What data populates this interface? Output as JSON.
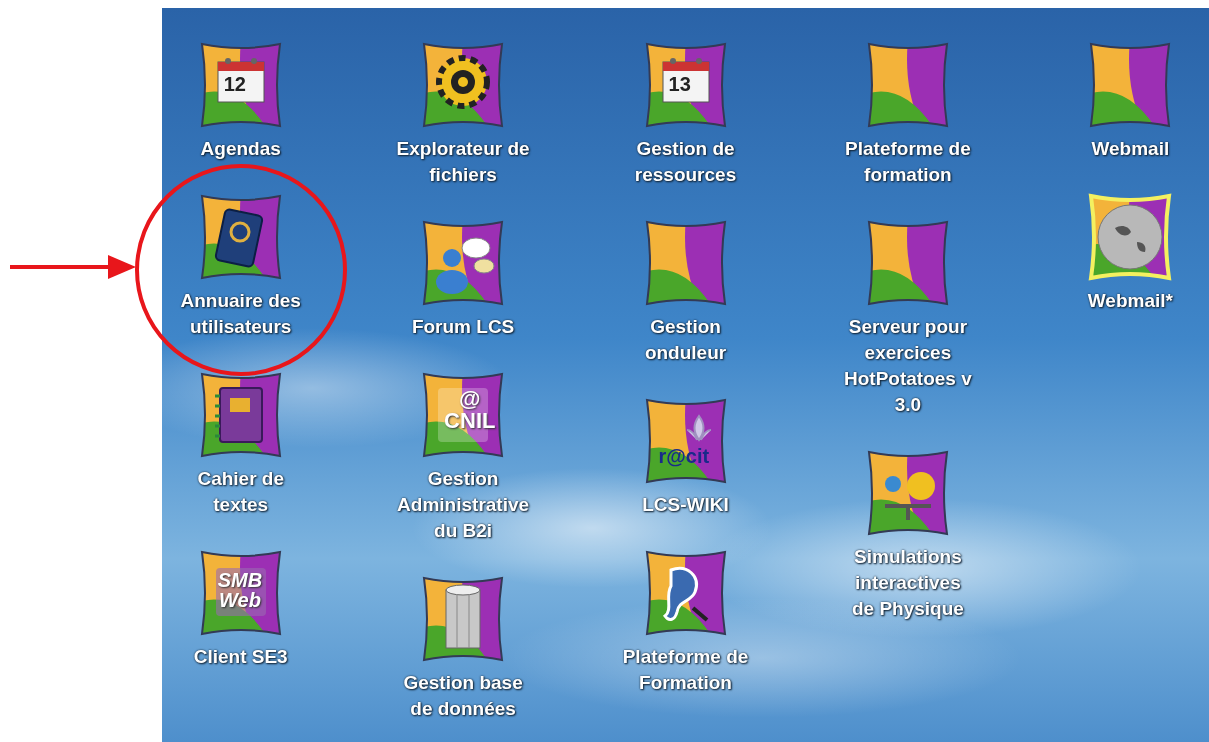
{
  "desktop": {
    "columns": [
      {
        "items": [
          {
            "label": "Agendas",
            "kind": "calendar",
            "badge": "12"
          },
          {
            "label": "Annuaire des\nutilisateurs",
            "kind": "address-book"
          },
          {
            "label": "Cahier de\ntextes",
            "kind": "notebook"
          },
          {
            "label": "Client SE3",
            "kind": "smb",
            "badge": "SMB\nWeb"
          }
        ]
      },
      {
        "items": [
          {
            "label": "Explorateur de\nfichiers",
            "kind": "gear"
          },
          {
            "label": "Forum LCS",
            "kind": "chat"
          },
          {
            "label": "Gestion\nAdministrative\ndu B2i",
            "kind": "cnil",
            "badge": "@\nCNIL"
          },
          {
            "label": "Gestion base\nde données",
            "kind": "database"
          }
        ]
      },
      {
        "items": [
          {
            "label": "Gestion de\nressources",
            "kind": "calendar",
            "badge": "13"
          },
          {
            "label": "Gestion\nonduleur",
            "kind": "blank"
          },
          {
            "label": "LCS-WIKI",
            "kind": "recit",
            "badge": "r@cit"
          },
          {
            "label": "Plateforme de\nFormation",
            "kind": "paint"
          }
        ]
      },
      {
        "items": [
          {
            "label": "Plateforme de\nformation",
            "kind": "blank"
          },
          {
            "label": "Serveur pour\nexercices\nHotPotatoes v\n3.0",
            "kind": "blank"
          },
          {
            "label": "Simulations\ninteractives\nde Physique",
            "kind": "planets"
          }
        ]
      },
      {
        "items": [
          {
            "label": "Webmail",
            "kind": "blank"
          },
          {
            "label": "Webmail*",
            "kind": "globe"
          }
        ]
      }
    ]
  }
}
